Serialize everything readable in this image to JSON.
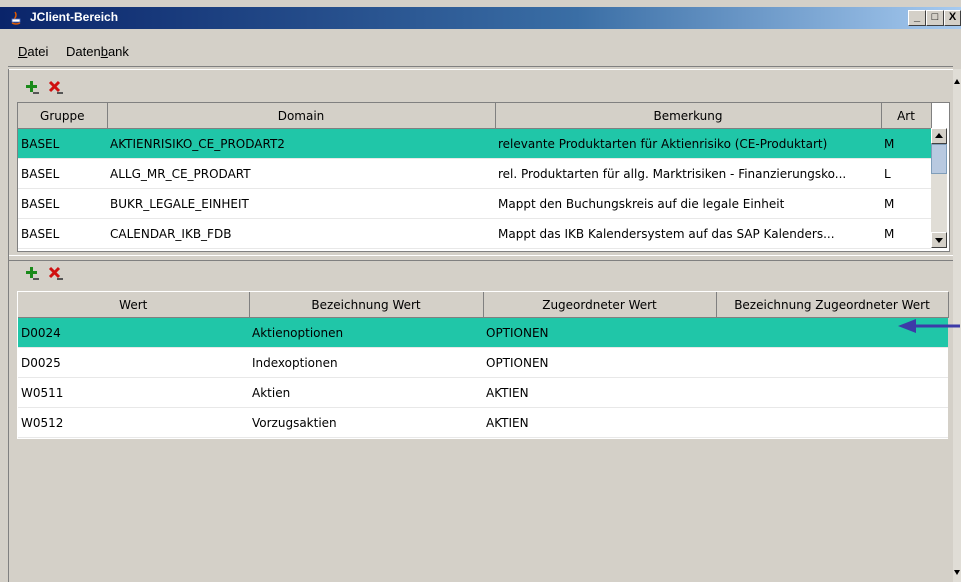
{
  "window": {
    "title": "JClient-Bereich",
    "btn_min": "_",
    "btn_max": "□",
    "btn_close": "X"
  },
  "menu": [
    {
      "label_pre": "",
      "label_ul": "D",
      "label_post": "atei"
    },
    {
      "label_pre": "Daten",
      "label_ul": "b",
      "label_post": "ank"
    }
  ],
  "domains": {
    "columns": [
      "Gruppe",
      "Domain",
      "Bemerkung",
      "Art"
    ],
    "rows": [
      [
        "BASEL",
        "AKTIENRISIKO_CE_PRODART2",
        "relevante Produktarten für Aktienrisiko (CE-Produktart)",
        "M"
      ],
      [
        "BASEL",
        "ALLG_MR_CE_PRODART",
        "rel. Produktarten für allg. Marktrisiken - Finanzierungsko...",
        "L"
      ],
      [
        "BASEL",
        "BUKR_LEGALE_EINHEIT",
        "Mappt den Buchungskreis auf die legale Einheit",
        "M"
      ],
      [
        "BASEL",
        "CALENDAR_IKB_FDB",
        "Mappt das IKB Kalendersystem auf das SAP Kalenders...",
        "M"
      ]
    ]
  },
  "values": {
    "columns": [
      "Wert",
      "Bezeichnung Wert",
      "Zugeordneter Wert",
      "Bezeichnung Zugeordneter Wert"
    ],
    "rows": [
      [
        "D0024",
        "Aktienoptionen",
        "OPTIONEN",
        ""
      ],
      [
        "D0025",
        "Indexoptionen",
        "OPTIONEN",
        ""
      ],
      [
        "W0511",
        "Aktien",
        "AKTIEN",
        ""
      ],
      [
        "W0512",
        "Vorzugsaktien",
        "AKTIEN",
        ""
      ]
    ]
  },
  "colors": {
    "selection": "#20c6a8",
    "titlebar": "#0a246a",
    "annotation_arrow": "#3d3aa8"
  }
}
